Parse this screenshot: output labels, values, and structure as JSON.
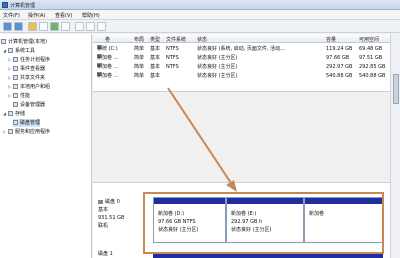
{
  "window": {
    "title": "计算机管理"
  },
  "menu": [
    "文件(F)",
    "操作(A)",
    "查看(V)",
    "帮助(H)"
  ],
  "tree": {
    "root": "计算机管理(本地)",
    "system_tools": "系统工具",
    "task_scheduler": "任务计划程序",
    "event_viewer": "事件查看器",
    "shared_folders": "共享文件夹",
    "local_users": "本地用户和组",
    "performance": "性能",
    "device_manager": "设备管理器",
    "storage": "存储",
    "disk_management": "磁盘管理",
    "services": "服务和应用程序"
  },
  "grid": {
    "columns": [
      "卷",
      "布局",
      "类型",
      "文件系统",
      "状态",
      "容量",
      "可用空间"
    ],
    "rows": [
      [
        "系统 (C:)",
        "简单",
        "基本",
        "NTFS",
        "状态良好 (系统, 启动, 页面文件, 活动...",
        "119.24 GB",
        "69.48 GB"
      ],
      [
        "新加卷 ...",
        "简单",
        "基本",
        "NTFS",
        "状态良好 (主分区)",
        "97.66 GB",
        "97.51 GB"
      ],
      [
        "新加卷 ...",
        "简单",
        "基本",
        "NTFS",
        "状态良好 (主分区)",
        "292.97 GB",
        "292.85 GB"
      ],
      [
        "新加卷 ...",
        "简单",
        "基本",
        "",
        "状态良好 (主分区)",
        "540.88 GB",
        "540.88 GB"
      ]
    ]
  },
  "disk0": {
    "name": "磁盘 0",
    "type": "基本",
    "size": "931.51 GB",
    "status": "联机"
  },
  "partitions": [
    {
      "name": "新加卷 (D:)",
      "size": "97.66 GB NTFS",
      "status": "状态良好 (主分区)"
    },
    {
      "name": "新加卷 (E:)",
      "size": "292.97 GB h",
      "status": "状态良好 (主分区)"
    },
    {
      "name": "新加卷",
      "size": "",
      "status": ""
    }
  ],
  "disk1": {
    "name": "磁盘 1"
  },
  "colors": {
    "partition_band": "#1f2fa0",
    "highlight": "#c88856"
  }
}
